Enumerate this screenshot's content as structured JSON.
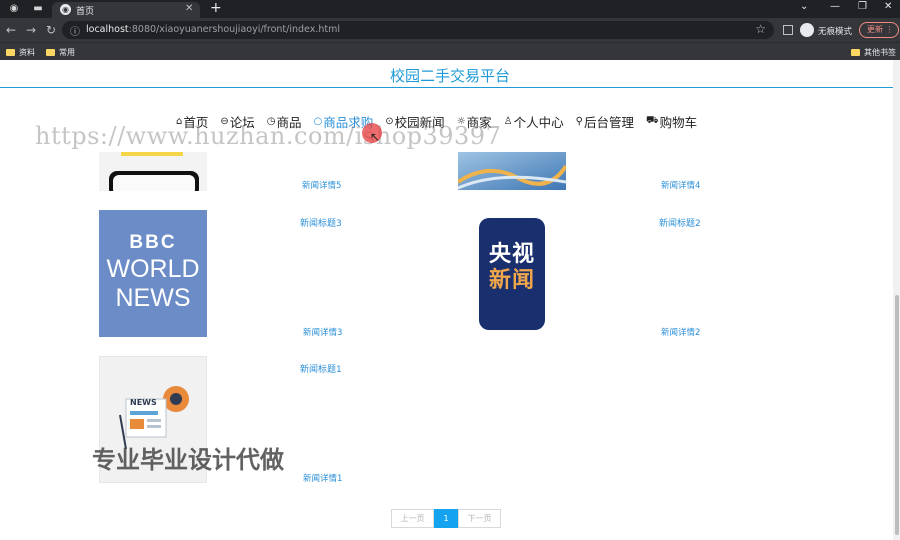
{
  "browser": {
    "tab_title": "首页",
    "url_host": "localhost",
    "url_rest": ":8080/xiaoyuanershoujiaoyi/front/index.html",
    "incognito_label": "无痕模式",
    "update_label": "更新",
    "bookmarks": [
      "资料",
      "常用",
      "其他书签"
    ]
  },
  "site": {
    "title": "校园二手交易平台"
  },
  "nav": [
    {
      "icon": "⌂",
      "label": "首页"
    },
    {
      "icon": "⊖",
      "label": "论坛"
    },
    {
      "icon": "◷",
      "label": "商品"
    },
    {
      "icon": "○",
      "label": "商品求购"
    },
    {
      "icon": "⊙",
      "label": "校园新闻"
    },
    {
      "icon": "☼",
      "label": "商家"
    },
    {
      "icon": "♙",
      "label": "个人中心"
    },
    {
      "icon": "⚲",
      "label": "后台管理"
    },
    {
      "icon": "⛟",
      "label": "购物车"
    }
  ],
  "watermark": "https://www.huzhan.com/ishop39397",
  "news": [
    {
      "detail": "新闻详情5"
    },
    {
      "detail": "新闻详情4"
    },
    {
      "title": "新闻标题3",
      "detail": "新闻详情3",
      "logo_lines": [
        "BBC",
        "WORLD",
        "NEWS"
      ]
    },
    {
      "title": "新闻标题2",
      "detail": "新闻详情2",
      "logo_lines": [
        "央视",
        "新闻"
      ]
    },
    {
      "title": "新闻标题1",
      "detail": "新闻详情1",
      "logo_lines": [
        "NEWS"
      ]
    }
  ],
  "overlay_text": "专业毕业设计代做",
  "pagination": {
    "prev": "上一页",
    "current": "1",
    "next": "下一页"
  },
  "colors": {
    "accent": "#1e9bd7",
    "link": "#2a8fd8",
    "bbc_bg": "#6b8cc7",
    "cctv_bg": "#1a2f6e"
  }
}
